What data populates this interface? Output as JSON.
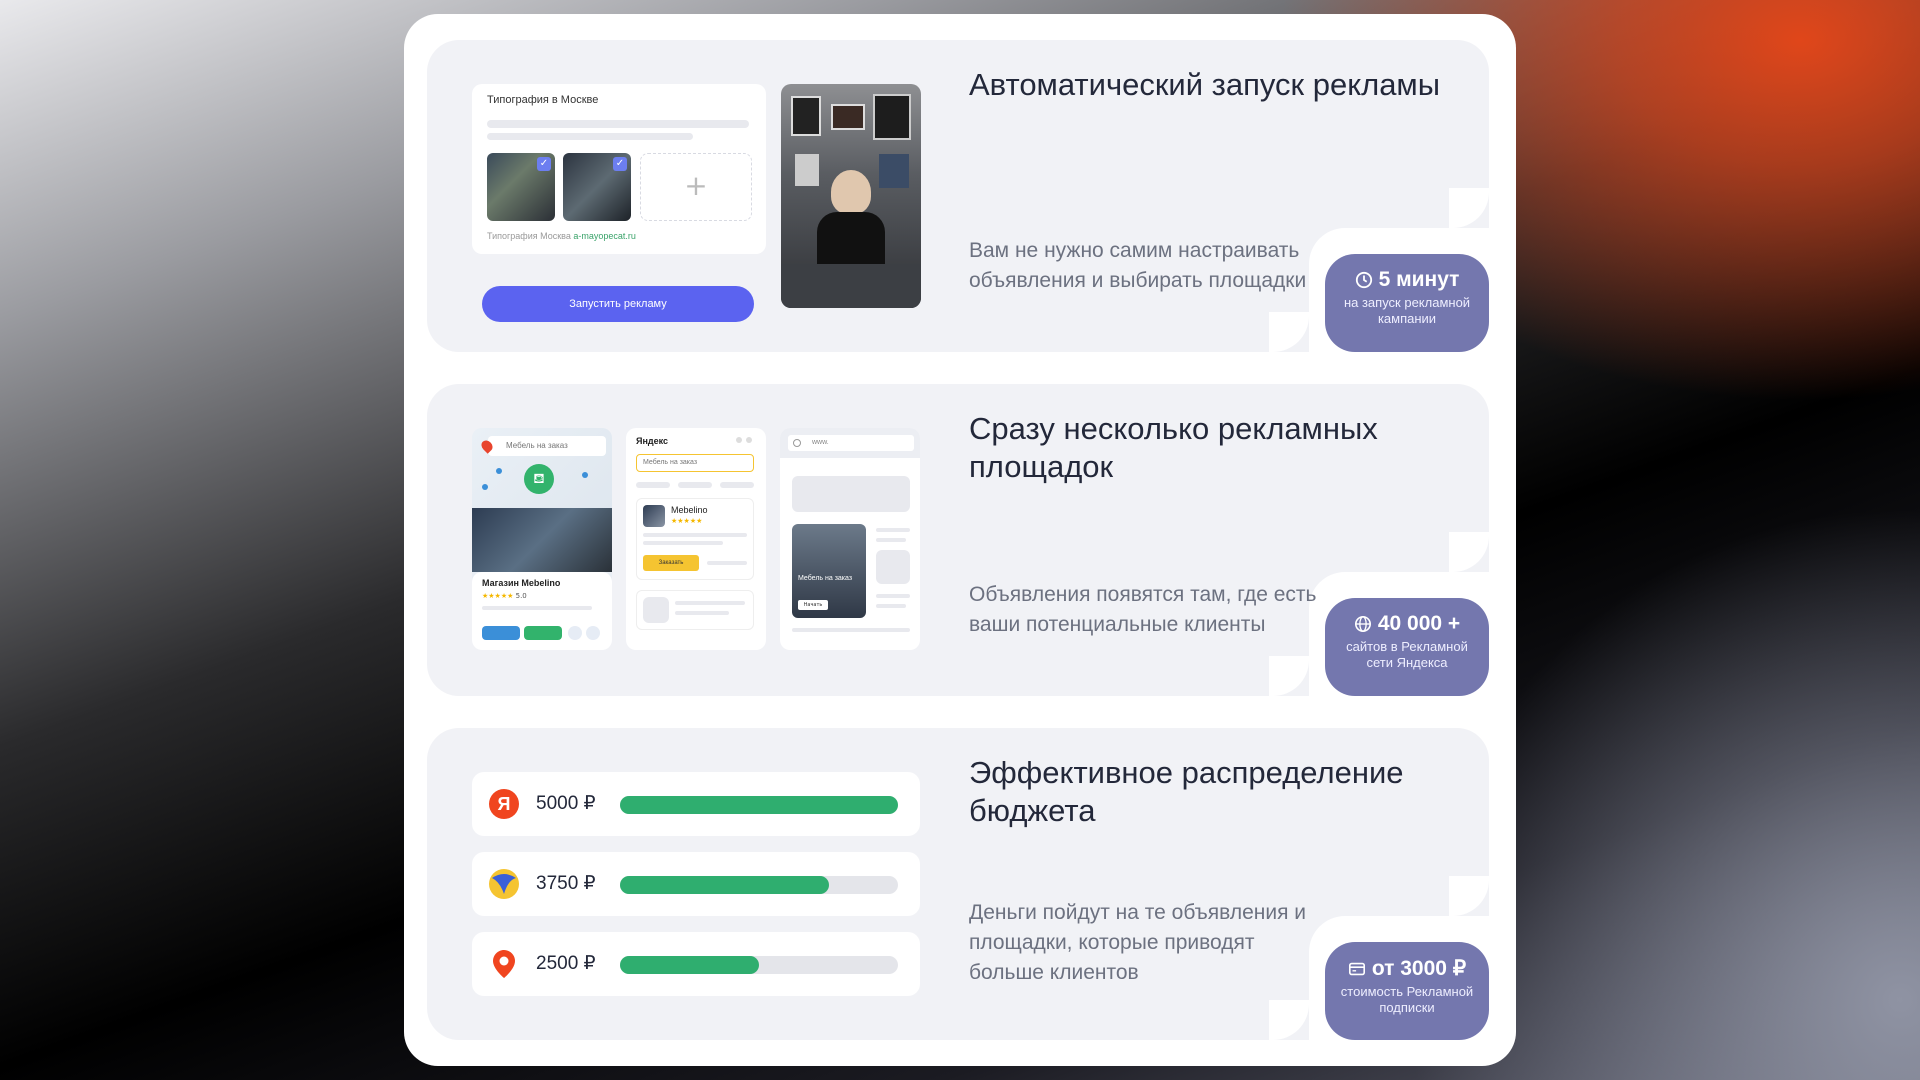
{
  "colors": {
    "accent": "#7477ae",
    "button": "#5b63f0",
    "bar": "#2fae6f",
    "panel": "#f1f2f6"
  },
  "sections": [
    {
      "title": "Автоматический запуск рекламы",
      "description": "Вам не нужно самим настраивать объявления и выбирать площадки",
      "badge": {
        "icon": "clock-icon",
        "value": "5 минут",
        "caption": "на запуск рекламной кампании"
      },
      "mock": {
        "heading": "Типография в Москве",
        "tags": "Типография   Москва   ",
        "link": "a-mayopecat.ru",
        "button": "Запустить рекламу"
      }
    },
    {
      "title": "Сразу несколько рекламных площадок",
      "description": "Объявления появятся там, где есть ваши потенциальные клиенты",
      "badge": {
        "icon": "globe-icon",
        "value": "40 000 +",
        "caption": "сайтов в Рекламной сети Яндекса"
      },
      "mock": {
        "map_search": "Мебель на заказ",
        "shop_name": "Магазин Mebelino",
        "rating": "5.0",
        "stars": "★★★★★",
        "search_logo": "Яндекс",
        "search_query": "Мебель на заказ",
        "result_name": "Mebelino",
        "result_button": "Заказать",
        "site_url": "www.",
        "ad_title": "Мебель на заказ",
        "ad_button": "Начать"
      }
    },
    {
      "title": "Эффективное распределение бюджета",
      "description": "Деньги пойдут на те объявления и площадки, которые приводят больше клиентов",
      "badge": {
        "icon": "card-icon",
        "value": "от 3000 ₽",
        "caption": "стоимость Рекламной подписки"
      },
      "budget": [
        {
          "icon": "yandex-icon",
          "amount": "5000 ₽",
          "fill_fraction": 1.0
        },
        {
          "icon": "ad-network-icon",
          "amount": "3750 ₽",
          "fill_fraction": 0.75
        },
        {
          "icon": "map-pin-icon",
          "amount": "2500 ₽",
          "fill_fraction": 0.5
        }
      ]
    }
  ]
}
